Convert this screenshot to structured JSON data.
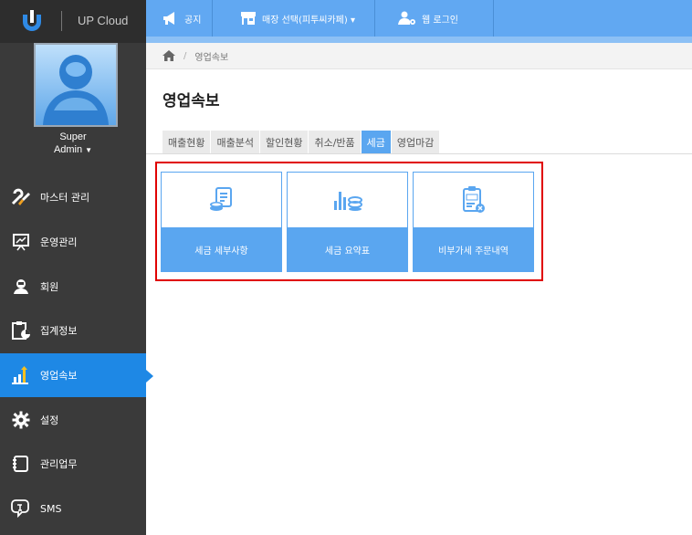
{
  "brand": {
    "name": "UP Cloud"
  },
  "user": {
    "name": "Super",
    "role": "Admin"
  },
  "topbar": {
    "notice": "공지",
    "store_select": "매장 선택(피투씨카페) ▾",
    "web_login": "웹 로그인"
  },
  "sidebar": {
    "items": [
      {
        "label": "마스터 관리",
        "icon": "tools-icon"
      },
      {
        "label": "운영관리",
        "icon": "presentation-icon"
      },
      {
        "label": "회원",
        "icon": "member-icon"
      },
      {
        "label": "집계정보",
        "icon": "clipboard-chart-icon"
      },
      {
        "label": "영업속보",
        "icon": "bar-chart-icon"
      },
      {
        "label": "설정",
        "icon": "gear-icon"
      },
      {
        "label": "관리업무",
        "icon": "notebook-icon"
      },
      {
        "label": "SMS",
        "icon": "sms-icon"
      }
    ]
  },
  "breadcrumb": {
    "current": "영업속보"
  },
  "page": {
    "title": "영업속보"
  },
  "tabs": [
    "매출현황",
    "매출분석",
    "할인현황",
    "취소/반품",
    "세금",
    "영업마감"
  ],
  "cards": [
    {
      "label": "세금 세부사항",
      "icon": "tax-detail-icon"
    },
    {
      "label": "세금 요약표",
      "icon": "tax-summary-icon"
    },
    {
      "label": "비부가세 주문내역",
      "icon": "vat-exempt-icon"
    }
  ],
  "colors": {
    "accent": "#1e88e5",
    "topbar": "#61a8f2",
    "card": "#5aa6f0",
    "highlight": "#e00000",
    "sidebar": "#3a3a3a"
  }
}
